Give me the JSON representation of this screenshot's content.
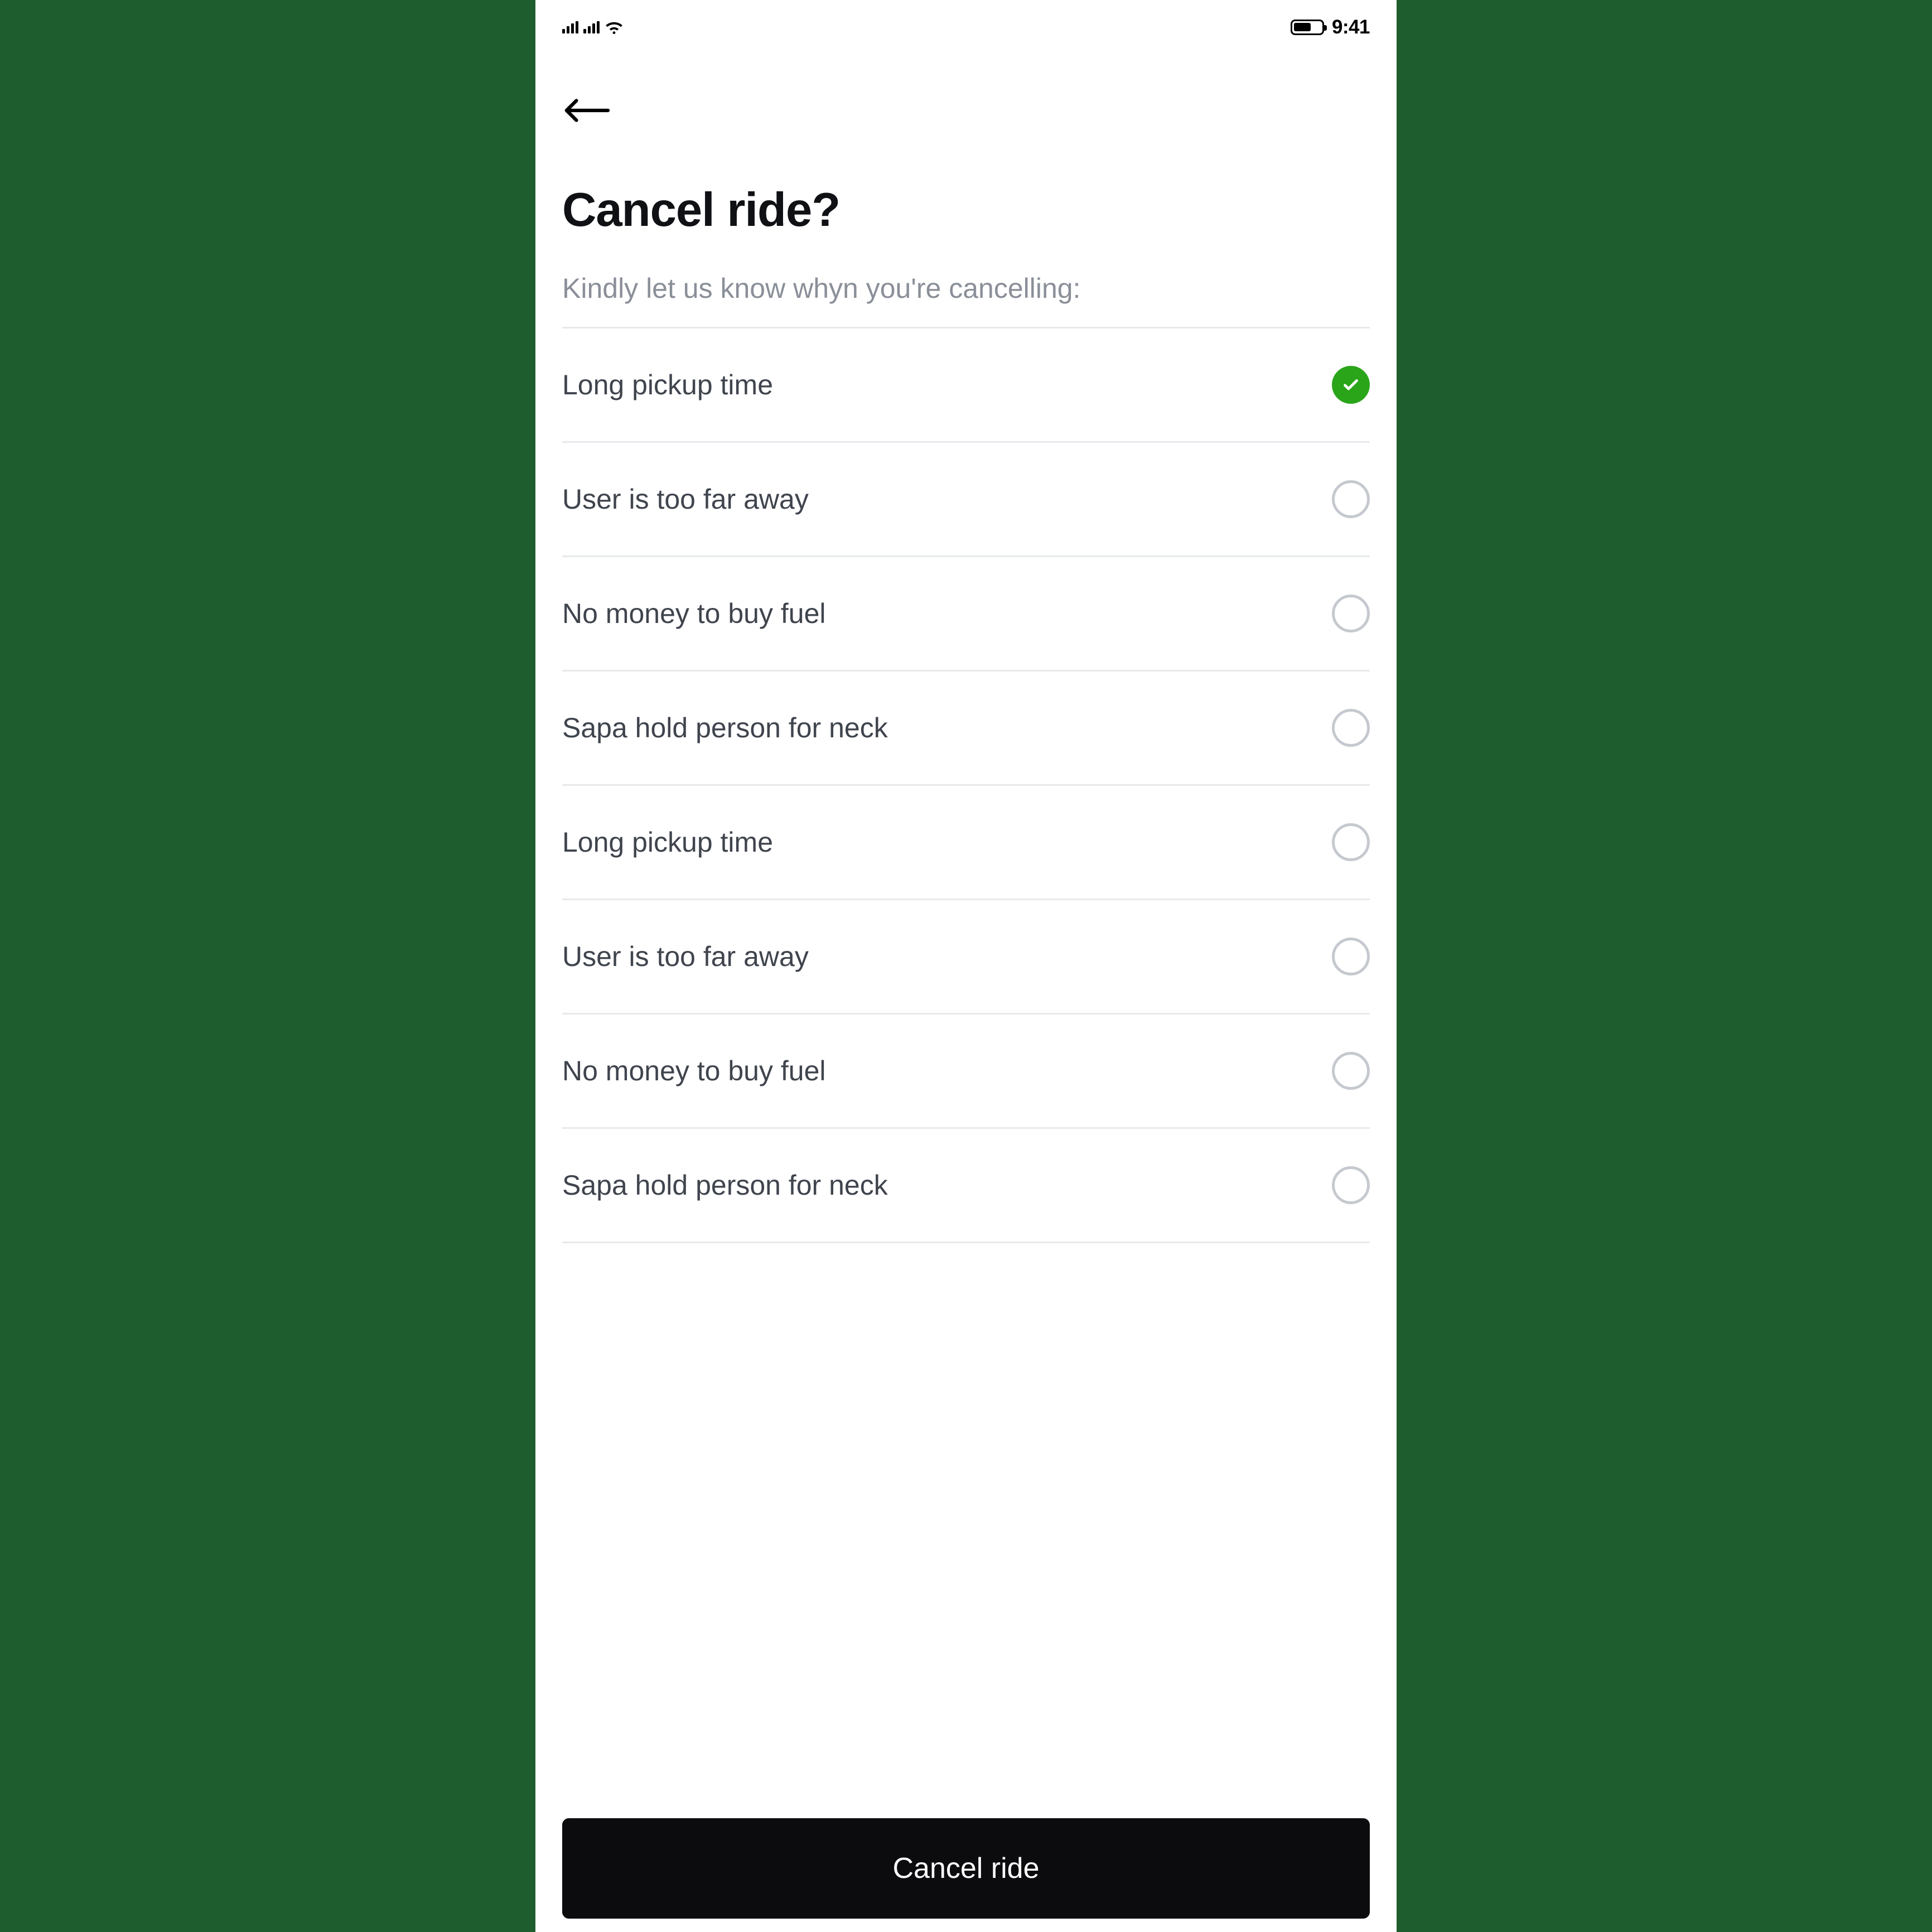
{
  "status": {
    "time": "9:41"
  },
  "header": {
    "title": "Cancel ride?",
    "subtitle": "Kindly let us know whyn you're cancelling:"
  },
  "reasons": [
    {
      "label": "Long pickup time",
      "selected": true
    },
    {
      "label": "User is too far away",
      "selected": false
    },
    {
      "label": "No money to buy fuel",
      "selected": false
    },
    {
      "label": "Sapa hold person for neck",
      "selected": false
    },
    {
      "label": "Long pickup time",
      "selected": false
    },
    {
      "label": "User is too far away",
      "selected": false
    },
    {
      "label": "No money to buy fuel",
      "selected": false
    },
    {
      "label": "Sapa hold person for neck",
      "selected": false
    }
  ],
  "cta": {
    "label": "Cancel ride"
  },
  "colors": {
    "accent": "#2aa51a",
    "text": "#0f1115",
    "muted": "#8a8f98",
    "divider": "#e7e9ec",
    "button": "#0c0c0e"
  }
}
